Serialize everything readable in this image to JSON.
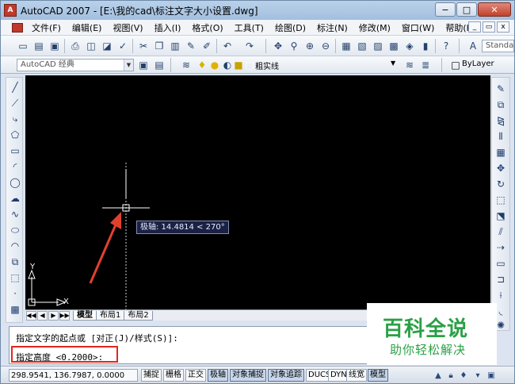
{
  "title_bar": {
    "app_icon_text": "A",
    "title": "AutoCAD 2007 - [E:\\我的cad\\标注文字大小设置.dwg]",
    "minimize": "−",
    "maximize": "□",
    "close": "✕"
  },
  "menu": {
    "items": [
      "文件(F)",
      "编辑(E)",
      "视图(V)",
      "插入(I)",
      "格式(O)",
      "工具(T)",
      "绘图(D)",
      "标注(N)",
      "修改(M)",
      "窗口(W)",
      "帮助(H)"
    ],
    "mdi_minimize": "_",
    "mdi_restore": "▭",
    "mdi_close": "x"
  },
  "toolbar": {
    "text_style_value": "Standa",
    "workspace_value": "AutoCAD 经典",
    "layer_value": "粗实线",
    "layer_dropdown_arrow": "▼",
    "linetype_value": "ByLayer"
  },
  "tabs": {
    "nav_first": "◀◀",
    "nav_prev": "◀",
    "nav_next": "▶",
    "nav_last": "▶▶",
    "model": "模型",
    "layout1": "布局1",
    "layout2": "布局2"
  },
  "drawing": {
    "tooltip": "极轴: 14.4814 < 270°",
    "ucs_y": "Y",
    "ucs_x": "X"
  },
  "command": {
    "line1": "指定文字的起点或 [对正(J)/样式(S)]:",
    "line2": "指定高度 <0.2000>:"
  },
  "watermark": {
    "title": "百科全说",
    "subtitle": "助你轻松解决"
  },
  "status": {
    "coordinates": "298.9541, 136.7987, 0.0000",
    "buttons": [
      "捕捉",
      "栅格",
      "正交",
      "极轴",
      "对象捕捉",
      "对象追踪",
      "DUCS",
      "DYN",
      "线宽",
      "模型"
    ]
  },
  "colors": {
    "highlight": "#e0281e",
    "watermark_green": "#2aa046",
    "canvas": "#000000"
  }
}
